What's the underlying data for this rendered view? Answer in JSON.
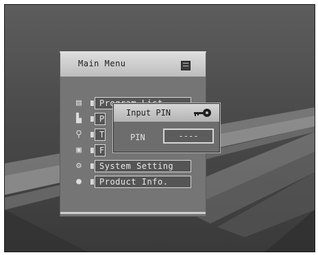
{
  "main_menu": {
    "title": "Main Menu",
    "items": [
      {
        "label": "Program List",
        "icon": "list-icon"
      },
      {
        "label": "P",
        "icon": "folder-icon"
      },
      {
        "label": "T",
        "icon": "search-icon"
      },
      {
        "label": "F",
        "icon": "tv-icon"
      },
      {
        "label": "System Setting",
        "icon": "gear-icon"
      },
      {
        "label": "Product Info.",
        "icon": "info-icon"
      }
    ]
  },
  "pin_dialog": {
    "title": "Input PIN",
    "pin_label": "PIN",
    "pin_value": "----"
  }
}
